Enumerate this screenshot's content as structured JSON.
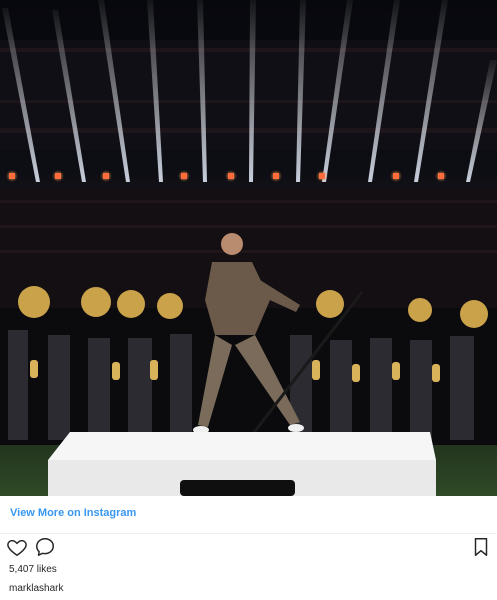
{
  "post": {
    "image_description_icon": "photo",
    "view_more_label": "View More on Instagram",
    "likes_label": "5,407 likes",
    "username": "marklashark"
  },
  "icons": {
    "like": "heart-outline-icon",
    "comment": "comment-bubble-icon",
    "save": "bookmark-icon"
  },
  "colors": {
    "link": "#3897f0",
    "text": "#262626",
    "stage": "#e9e9e9"
  }
}
